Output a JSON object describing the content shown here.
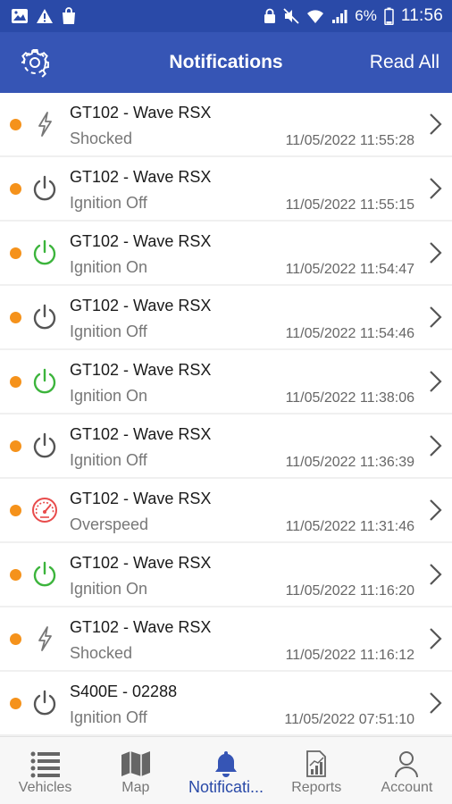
{
  "status_bar": {
    "battery_percent": "6%",
    "time": "11:56"
  },
  "app_bar": {
    "title": "Notifications",
    "read_all_label": "Read All"
  },
  "colors": {
    "primary": "#3655b5",
    "unread_dot": "#f5921b",
    "ignition_on": "#3cb43c",
    "ignition_off": "#555555",
    "overspeed": "#e84b4b",
    "shocked": "#777777"
  },
  "notifications": [
    {
      "vehicle": "GT102 - Wave RSX",
      "event": "Shocked",
      "timestamp": "11/05/2022 11:55:28",
      "icon": "lightning-icon"
    },
    {
      "vehicle": "GT102 - Wave RSX",
      "event": "Ignition Off",
      "timestamp": "11/05/2022 11:55:15",
      "icon": "power-off-icon"
    },
    {
      "vehicle": "GT102 - Wave RSX",
      "event": "Ignition On",
      "timestamp": "11/05/2022 11:54:47",
      "icon": "power-on-icon"
    },
    {
      "vehicle": "GT102 - Wave RSX",
      "event": "Ignition Off",
      "timestamp": "11/05/2022 11:54:46",
      "icon": "power-off-icon"
    },
    {
      "vehicle": "GT102 - Wave RSX",
      "event": "Ignition On",
      "timestamp": "11/05/2022 11:38:06",
      "icon": "power-on-icon"
    },
    {
      "vehicle": "GT102 - Wave RSX",
      "event": "Ignition Off",
      "timestamp": "11/05/2022 11:36:39",
      "icon": "power-off-icon"
    },
    {
      "vehicle": "GT102 - Wave RSX",
      "event": "Overspeed",
      "timestamp": "11/05/2022 11:31:46",
      "icon": "speedometer-icon"
    },
    {
      "vehicle": "GT102 - Wave RSX",
      "event": "Ignition On",
      "timestamp": "11/05/2022 11:16:20",
      "icon": "power-on-icon"
    },
    {
      "vehicle": "GT102 - Wave RSX",
      "event": "Shocked",
      "timestamp": "11/05/2022 11:16:12",
      "icon": "lightning-icon"
    },
    {
      "vehicle": "S400E - 02288",
      "event": "Ignition Off",
      "timestamp": "11/05/2022 07:51:10",
      "icon": "power-off-icon"
    }
  ],
  "tab_bar": {
    "tabs": [
      {
        "label": "Vehicles",
        "icon": "list-icon",
        "active": false
      },
      {
        "label": "Map",
        "icon": "map-icon",
        "active": false
      },
      {
        "label": "Notificati...",
        "icon": "bell-icon",
        "active": true
      },
      {
        "label": "Reports",
        "icon": "reports-icon",
        "active": false
      },
      {
        "label": "Account",
        "icon": "account-icon",
        "active": false
      }
    ]
  }
}
